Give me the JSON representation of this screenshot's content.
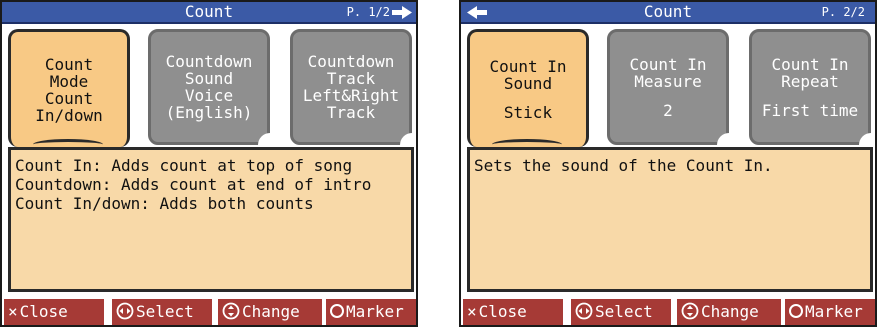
{
  "screen1": {
    "title": "Count",
    "page": "P. 1/2",
    "tabs": [
      {
        "lines": [
          "Count",
          "Mode",
          "Count",
          "In/down"
        ]
      },
      {
        "lines": [
          "Countdown",
          "Sound",
          "Voice",
          "(English)"
        ]
      },
      {
        "lines": [
          "Countdown",
          "Track",
          "Left&Right",
          "Track"
        ]
      }
    ],
    "description": [
      "Count In: Adds count at top of song",
      "Countdown: Adds count at end of intro",
      "Count In/down: Adds both counts"
    ]
  },
  "screen2": {
    "title": "Count",
    "page": "P. 2/2",
    "tabs": [
      {
        "name": [
          "Count In",
          "Sound"
        ],
        "value": "Stick"
      },
      {
        "name": [
          "Count In",
          "Measure"
        ],
        "value": "2"
      },
      {
        "name": [
          "Count In",
          "Repeat"
        ],
        "value": "First time"
      }
    ],
    "description": [
      "Sets the sound of the Count In."
    ]
  },
  "footer": {
    "close": "Close",
    "select": "Select",
    "change": "Change",
    "marker": "Marker"
  },
  "icons": {
    "next_page": "arrow-right-icon",
    "prev_page": "arrow-left-icon",
    "close": "x-icon",
    "select": "left-right-dial-icon",
    "change": "up-down-dial-icon",
    "marker": "circle-icon"
  },
  "colors": {
    "titlebar": "#3b5aa6",
    "active_tab": "#f8c985",
    "inactive_tab": "#8f8f8f",
    "description_bg": "#f8d9a8",
    "footer_button": "#a63a36"
  }
}
